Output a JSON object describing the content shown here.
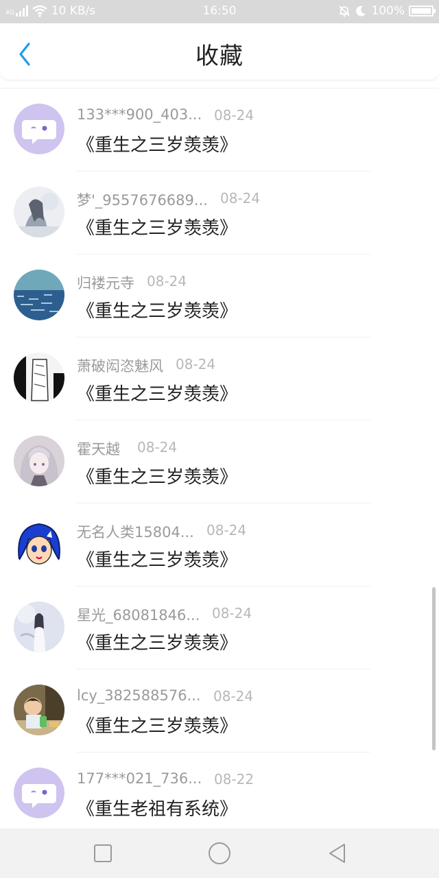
{
  "status_bar": {
    "network_label": "4G",
    "speed": "10 KB/s",
    "time": "16:50",
    "battery": "100%",
    "battery_level": 1.0,
    "icons": [
      "signal-icon",
      "wifi-icon",
      "mute-bell-icon",
      "moon-icon",
      "battery-icon"
    ]
  },
  "header": {
    "back_icon": "chevron-left-icon",
    "title": "收藏",
    "accent_color": "#1e9bf0"
  },
  "items": [
    {
      "user": "133***900_403...",
      "date": "08-24",
      "book": "《重生之三岁羡羡》",
      "avatar": "chat-bubble"
    },
    {
      "user": "梦'_9557676689...",
      "date": "08-24",
      "book": "《重生之三岁羡羡》",
      "avatar": "anime-girl-white"
    },
    {
      "user": "归褛元寺",
      "date": "08-24",
      "book": "《重生之三岁羡羡》",
      "avatar": "sea"
    },
    {
      "user": "萧破闳恣魅风",
      "date": "08-24",
      "book": "《重生之三岁羡羡》",
      "avatar": "manga-sketch"
    },
    {
      "user": "霍天越",
      "date": "08-24",
      "book": "《重生之三岁羡羡》",
      "avatar": "anime-girl-silver"
    },
    {
      "user": "无名人类15804...",
      "date": "08-24",
      "book": "《重生之三岁羡羡》",
      "avatar": "cartoon-blue-hair"
    },
    {
      "user": "星光_68081846...",
      "date": "08-24",
      "book": "《重生之三岁羡羡》",
      "avatar": "white-dress-figure"
    },
    {
      "user": "lcy_382588576...",
      "date": "08-24",
      "book": "《重生之三岁羡羡》",
      "avatar": "child-photo"
    },
    {
      "user": "177***021_736...",
      "date": "08-22",
      "book": "《重生老祖有系统》",
      "avatar": "chat-bubble"
    }
  ],
  "nav_bar": {
    "icons": [
      "recent-apps-icon",
      "home-icon",
      "back-triangle-icon"
    ]
  }
}
